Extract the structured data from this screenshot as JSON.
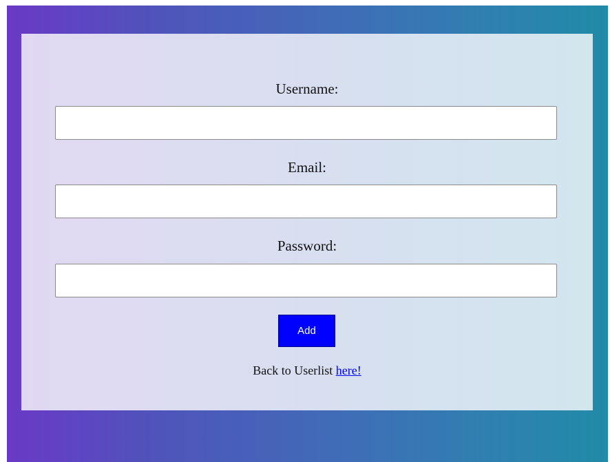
{
  "form": {
    "username_label": "Username:",
    "username_value": "",
    "email_label": "Email:",
    "email_value": "",
    "password_label": "Password:",
    "password_value": "",
    "add_button_label": "Add",
    "back_text": "Back to Userlist",
    "back_link_label": "here!"
  },
  "colors": {
    "button_background": "#0000ff",
    "link_color": "#0000ee",
    "page_gradient_start": "#6a39c6",
    "page_gradient_end": "#218ba8"
  }
}
